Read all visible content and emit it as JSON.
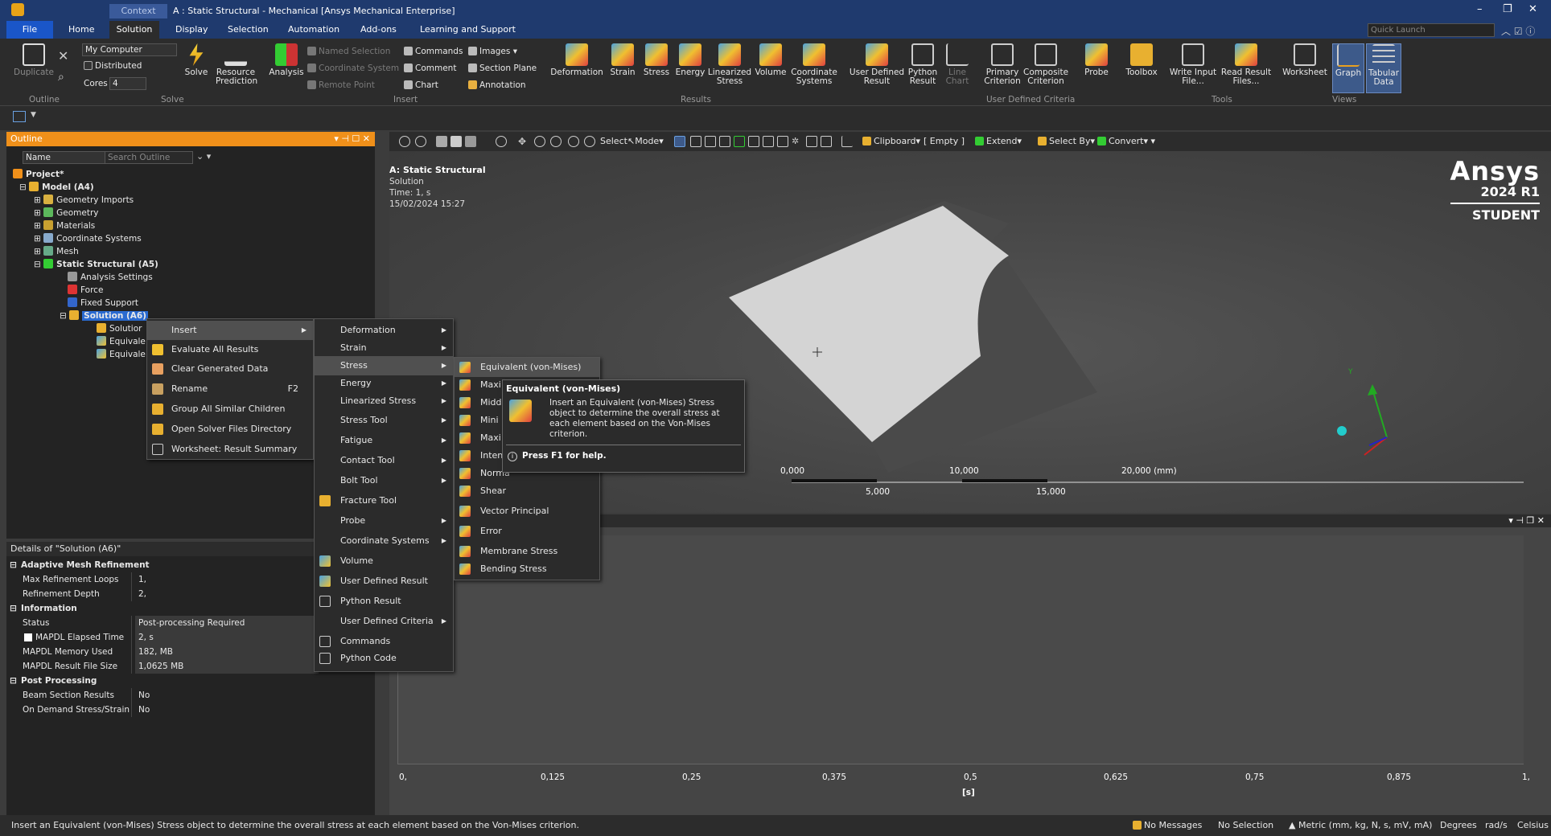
{
  "window": {
    "context_tab": "Context",
    "title": "A : Static Structural - Mechanical [Ansys Mechanical Enterprise]"
  },
  "tabs": [
    "File",
    "Home",
    "Solution",
    "Display",
    "Selection",
    "Automation",
    "Add-ons",
    "Learning and Support"
  ],
  "quick_launch_placeholder": "Quick Launch",
  "ribbon": {
    "outline": {
      "duplicate": "Duplicate",
      "group": "Outline"
    },
    "solve": {
      "machine": "My Computer",
      "distributed": "Distributed",
      "cores_label": "Cores",
      "cores_value": "4",
      "solve": "Solve",
      "resource": "Resource Prediction",
      "group": "Solve"
    },
    "insert": {
      "analysis": "Analysis",
      "named_selection": "Named Selection",
      "coordinate_system": "Coordinate System",
      "remote_point": "Remote Point",
      "commands": "Commands",
      "comment": "Comment",
      "chart": "Chart",
      "images": "Images",
      "section_plane": "Section Plane",
      "annotation": "Annotation",
      "group": "Insert"
    },
    "results": {
      "deformation": "Deformation",
      "strain": "Strain",
      "stress": "Stress",
      "energy": "Energy",
      "linearized": "Linearized Stress",
      "volume": "Volume",
      "coord": "Coordinate Systems",
      "user_defined": "User Defined Result",
      "python_result": "Python Result",
      "line_chart": "Line Chart",
      "group": "Results"
    },
    "udc": {
      "primary": "Primary Criterion",
      "composite": "Composite Criterion",
      "group": "User Defined Criteria"
    },
    "tools": {
      "probe": "Probe",
      "toolbox": "Toolbox",
      "write_input": "Write Input File...",
      "read_result": "Read Result Files...",
      "group": "Tools"
    },
    "views": {
      "worksheet": "Worksheet",
      "graph": "Graph",
      "tabular": "Tabular Data",
      "group": "Views"
    }
  },
  "outline": {
    "header": "Outline",
    "name_col": "Name",
    "search_placeholder": "Search Outline",
    "tree": [
      "Project*",
      "Model (A4)",
      "Geometry Imports",
      "Geometry",
      "Materials",
      "Coordinate Systems",
      "Mesh",
      "Static Structural (A5)",
      "Analysis Settings",
      "Force",
      "Fixed Support",
      "Solution (A6)",
      "Solutior",
      "Equivale",
      "Equivale"
    ]
  },
  "details": {
    "header": "Details of \"Solution (A6)\"",
    "sections": [
      {
        "title": "Adaptive Mesh Refinement",
        "rows": [
          [
            "Max Refinement Loops",
            "1,"
          ],
          [
            "Refinement Depth",
            "2,"
          ]
        ]
      },
      {
        "title": "Information",
        "rows": [
          [
            "Status",
            "Post-processing Required"
          ],
          [
            "MAPDL Elapsed Time",
            "2, s"
          ],
          [
            "MAPDL Memory Used",
            "182, MB"
          ],
          [
            "MAPDL Result File Size",
            "1,0625 MB"
          ]
        ]
      },
      {
        "title": "Post Processing",
        "rows": [
          [
            "Beam Section Results",
            "No"
          ],
          [
            "On Demand Stress/Strain",
            "No"
          ]
        ]
      }
    ]
  },
  "graphics_toolbar": {
    "select": "Select",
    "mode": "Mode",
    "clipboard": "Clipboard",
    "empty": "[ Empty ]",
    "extend": "Extend",
    "select_by": "Select By",
    "convert": "Convert"
  },
  "viewport": {
    "analysis": "A: Static Structural",
    "type": "Solution",
    "time": "Time: 1, s",
    "date": "15/02/2024 15:27",
    "brand": "Ansys",
    "version": "2024 R1",
    "edition": "STUDENT",
    "scale_top": [
      "0,000",
      "10,000",
      "20,000 (mm)"
    ],
    "scale_bottom": [
      "5,000",
      "15,000"
    ],
    "triad_y": "Y"
  },
  "graph": {
    "ticks": [
      "0,",
      "0,125",
      "0,25",
      "0,375",
      "0,5",
      "0,625",
      "0,75",
      "0,875",
      "1,"
    ],
    "unit": "[s]"
  },
  "context_menu": [
    {
      "label": "Insert",
      "arrow": true
    },
    {
      "label": "Evaluate All Results"
    },
    {
      "label": "Clear Generated Data"
    },
    {
      "label": "Rename",
      "key": "F2"
    },
    {
      "label": "Group All Similar Children"
    },
    {
      "label": "Open Solver Files Directory"
    },
    {
      "label": "Worksheet: Result Summary"
    }
  ],
  "insert_menu": [
    "Deformation",
    "Strain",
    "Stress",
    "Energy",
    "Linearized Stress",
    "Stress Tool",
    "Fatigue",
    "Contact Tool",
    "Bolt Tool",
    "Fracture Tool",
    "Probe",
    "Coordinate Systems",
    "Volume",
    "User Defined Result",
    "Python Result",
    "User Defined Criteria",
    "Commands",
    "Python Code"
  ],
  "stress_menu": [
    "Equivalent (von-Mises)",
    "Maxi",
    "Midd",
    "Mini",
    "Maxi",
    "Inten",
    "Norma",
    "Shear",
    "Vector Principal",
    "Error",
    "Membrane Stress",
    "Bending Stress"
  ],
  "tooltip": {
    "title": "Equivalent (von-Mises)",
    "body": "Insert an Equivalent (von-Mises) Stress object to determine the overall stress at each element based on the Von-Mises criterion.",
    "help": "Press F1 for help."
  },
  "status": {
    "message": "Insert an Equivalent (von-Mises) Stress object to determine the overall stress at each element based on the Von-Mises criterion.",
    "messages": "No Messages",
    "selection": "No Selection",
    "units": "Metric (mm, kg, N, s, mV, mA)",
    "angle": "Degrees",
    "rot": "rad/s",
    "temp": "Celsius"
  }
}
